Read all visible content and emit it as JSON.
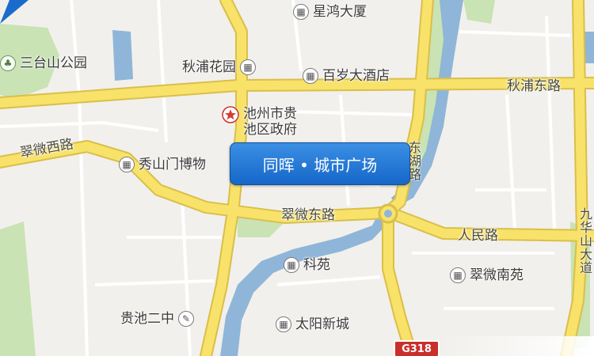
{
  "map": {
    "roads": {
      "qiupu_east": "秋浦东路",
      "cuiwei_west": "翠微西路",
      "cuiwei_east": "翠微东路",
      "renmin": "人民路",
      "jiuhuashan": "九华山大道",
      "east_road_vertical": "东湖路"
    },
    "pois": {
      "xinghong": "星鸿大厦",
      "santaishan_park": "三台山公园",
      "qiupu_garden": "秋浦花园",
      "baisui_hotel": "百岁大酒店",
      "gov_line1": "池州市贵",
      "gov_line2": "池区政府",
      "xiushanmen_museum": "秀山门博物",
      "keyuan": "科苑",
      "cuiwei_nanyuan": "翠微南苑",
      "guichi_no2": "贵池二中",
      "taiyang_xincheng": "太阳新城"
    },
    "callout_label": "同晖 • 城市广场",
    "highway_shield": "G318",
    "icons": {
      "building": "building-icon",
      "park": "park-icon",
      "government": "government-star-icon",
      "school": "school-icon"
    },
    "colors": {
      "background": "#f2f0ec",
      "major_road": "#f8e26a",
      "water": "#8fb6d8",
      "green": "#c9e3b4",
      "callout": "#1f75d3",
      "shield": "#c9302c"
    }
  }
}
